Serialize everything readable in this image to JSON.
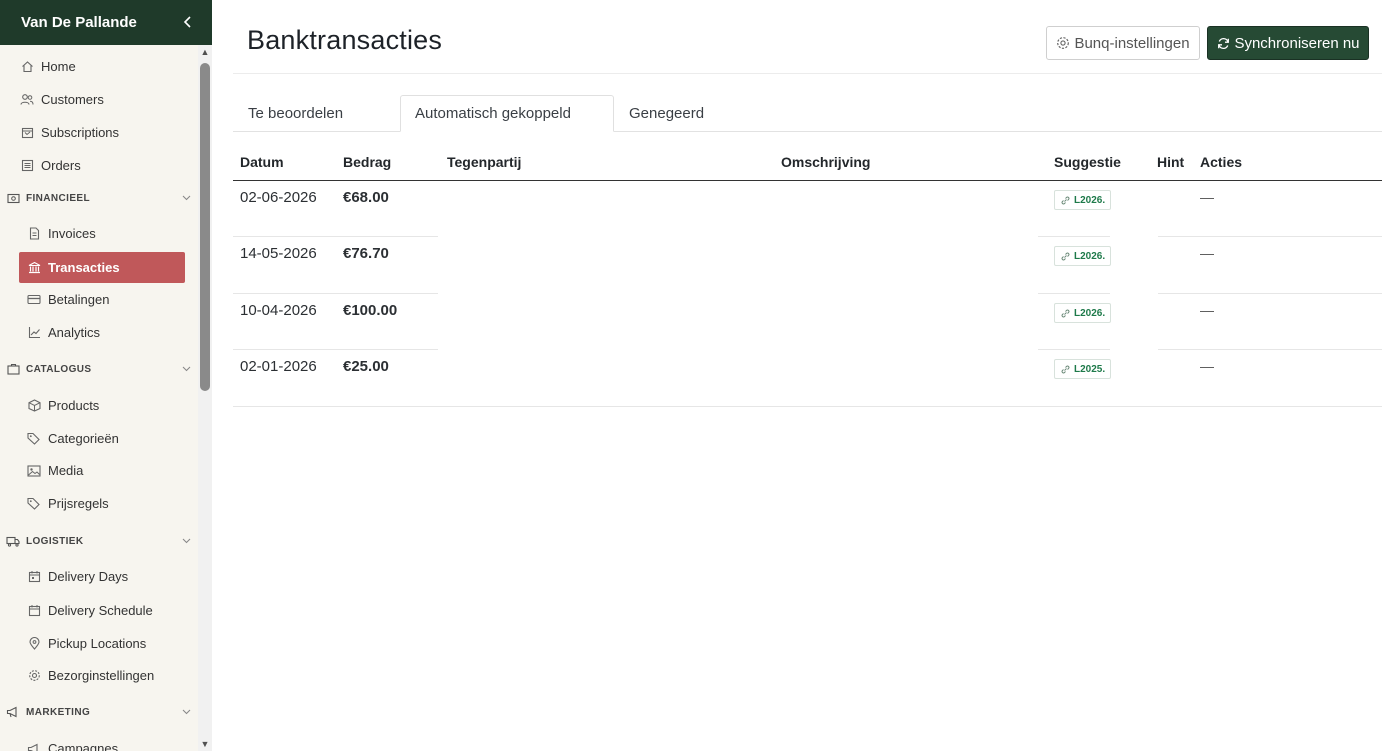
{
  "sidebar": {
    "brand": "Van De Pallande",
    "items": {
      "home": "Home",
      "customers": "Customers",
      "subscriptions": "Subscriptions",
      "orders": "Orders",
      "invoices": "Invoices",
      "transacties": "Transacties",
      "betalingen": "Betalingen",
      "analytics": "Analytics",
      "products": "Products",
      "categorieen": "Categorieën",
      "media": "Media",
      "prijsregels": "Prijsregels",
      "delivery_days": "Delivery Days",
      "delivery_schedule": "Delivery Schedule",
      "pickup_locations": "Pickup Locations",
      "bezorginstellingen": "Bezorginstellingen",
      "campagnes": "Campagnes"
    },
    "sections": {
      "financieel": "FINANCIEEL",
      "catalogus": "CATALOGUS",
      "logistiek": "LOGISTIEK",
      "marketing": "MARKETING"
    }
  },
  "header": {
    "title": "Banktransacties",
    "settings_label": "Bunq-instellingen",
    "sync_label": "Synchroniseren nu"
  },
  "tabs": {
    "review": "Te beoordelen",
    "auto": "Automatisch gekoppeld",
    "ignored": "Genegeerd"
  },
  "table": {
    "columns": {
      "datum": "Datum",
      "bedrag": "Bedrag",
      "tegenpartij": "Tegenpartij",
      "omschrijving": "Omschrijving",
      "suggestie": "Suggestie",
      "hint": "Hint",
      "acties": "Acties"
    },
    "rows": [
      {
        "datum": "02-06-2026",
        "bedrag": "€68.00",
        "suggestie": "L2026.",
        "acties": "—"
      },
      {
        "datum": "14-05-2026",
        "bedrag": "€76.70",
        "suggestie": "L2026.",
        "acties": "—"
      },
      {
        "datum": "10-04-2026",
        "bedrag": "€100.00",
        "suggestie": "L2026.",
        "acties": "—"
      },
      {
        "datum": "02-01-2026",
        "bedrag": "€25.00",
        "suggestie": "L2025.",
        "acties": "—"
      }
    ]
  },
  "colors": {
    "brand_bg": "#1f3a2a",
    "active_item": "#c0585a",
    "sync_button": "#264a34",
    "suggestion_text": "#1e7a4a"
  }
}
